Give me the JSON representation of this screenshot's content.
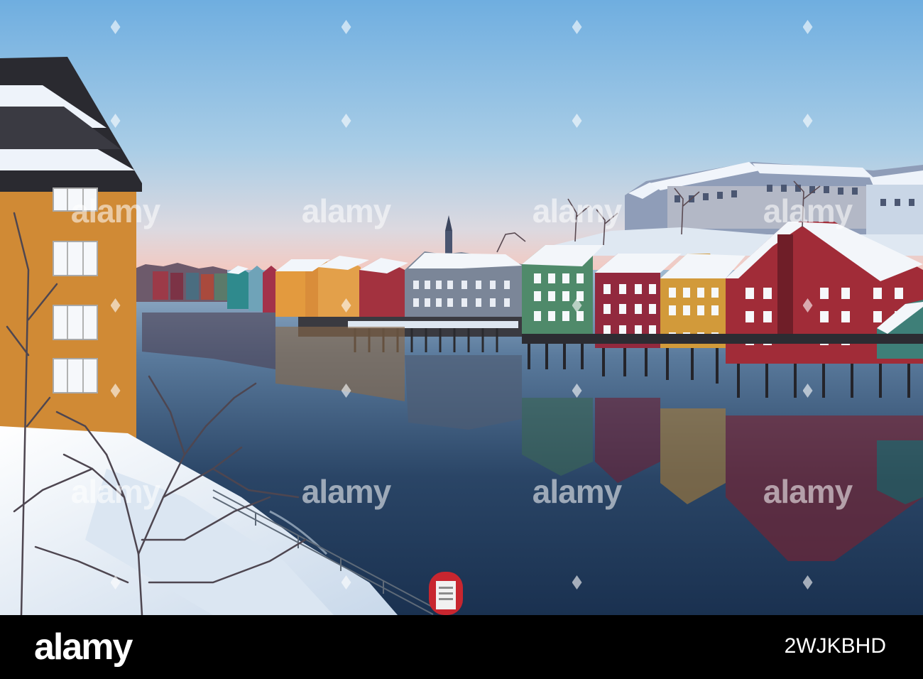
{
  "watermark": {
    "logo_text": "alamy"
  },
  "footer": {
    "logo_text": "alamy",
    "image_id": "2WJKBHD"
  },
  "colors": {
    "sky_top": "#7fb6e0",
    "sky_horizon": "#f3c9c1",
    "water": "#1b3552",
    "snow": "#e8f0f8",
    "footer_background": "#000000"
  },
  "photo": {
    "buoy_icon": "life-buoy-icon"
  }
}
